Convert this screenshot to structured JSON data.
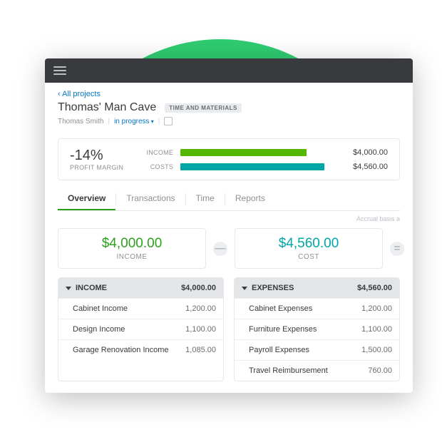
{
  "header": {
    "back": "‹ All projects",
    "title": "Thomas' Man Cave",
    "tag": "TIME AND MATERIALS",
    "customer": "Thomas Smith",
    "status": "in progress"
  },
  "metrics": {
    "margin": "-14%",
    "margin_label": "PROFIT MARGIN",
    "income_label": "INCOME",
    "cost_label": "COSTS",
    "income_val": "$4,000.00",
    "cost_val": "$4,560.00"
  },
  "tabs": [
    "Overview",
    "Transactions",
    "Time",
    "Reports"
  ],
  "accrual": "Accrual basis a",
  "summary": {
    "income_amount": "$4,000.00",
    "income_label": "INCOME",
    "cost_amount": "$4,560.00",
    "cost_label": "COST",
    "minus": "—",
    "equals": "="
  },
  "income_list": {
    "title": "INCOME",
    "total": "$4,000.00",
    "rows": [
      {
        "label": "Cabinet Income",
        "val": "1,200.00"
      },
      {
        "label": "Design Income",
        "val": "1,100.00"
      },
      {
        "label": "Garage Renovation Income",
        "val": "1,085.00"
      }
    ]
  },
  "expense_list": {
    "title": "EXPENSES",
    "total": "$4,560.00",
    "rows": [
      {
        "label": "Cabinet Expenses",
        "val": "1,200.00"
      },
      {
        "label": "Furniture Expenses",
        "val": "1,100.00"
      },
      {
        "label": "Payroll Expenses",
        "val": "1,500.00"
      },
      {
        "label": "Travel Reimbursement",
        "val": "760.00"
      }
    ]
  },
  "chart_data": {
    "type": "bar",
    "orientation": "horizontal",
    "title": "Profit Margin",
    "categories": [
      "INCOME",
      "COSTS"
    ],
    "values": [
      4000.0,
      4560.0
    ],
    "series": [
      {
        "name": "INCOME",
        "values": [
          4000.0
        ],
        "color": "#53b700"
      },
      {
        "name": "COSTS",
        "values": [
          4560.0
        ],
        "color": "#00a6a4"
      }
    ],
    "xlabel": "",
    "ylabel": "",
    "ylim": [
      0,
      5000
    ],
    "derived": {
      "profit_margin_pct": -14
    }
  }
}
